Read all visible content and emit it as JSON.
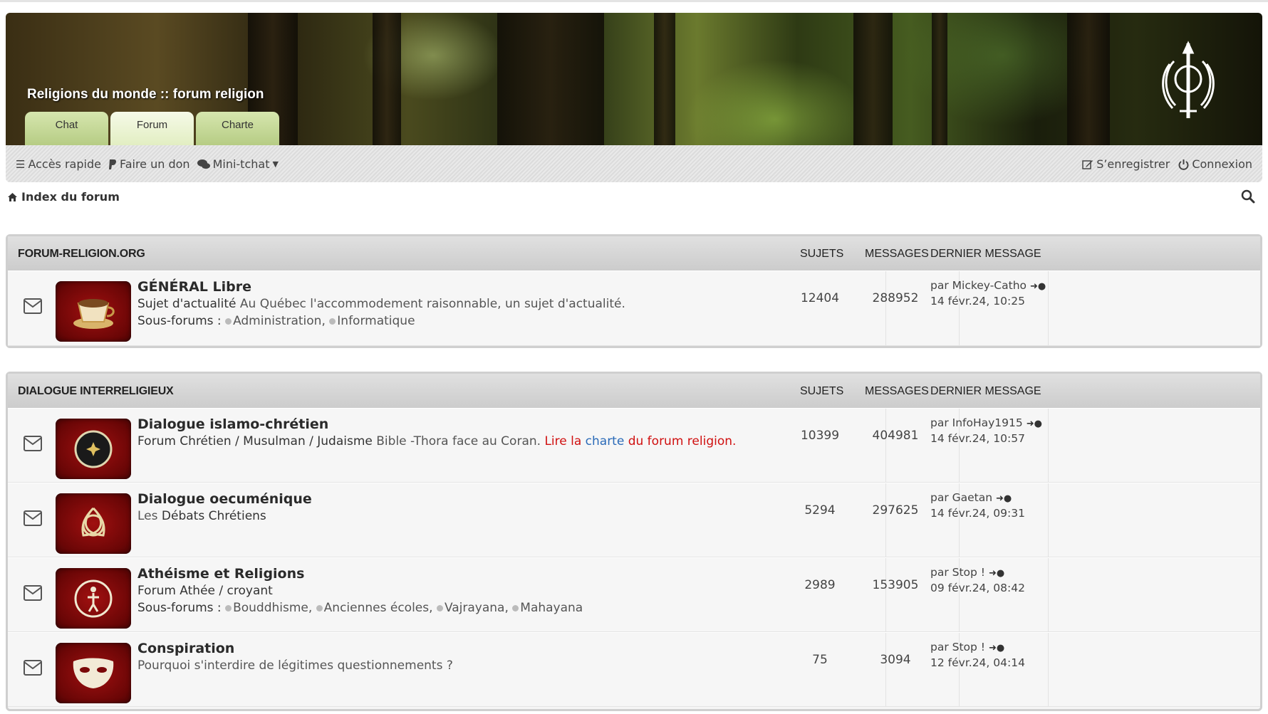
{
  "banner": {
    "title": "Religions du monde :: forum religion",
    "tabs": [
      "Chat",
      "Forum",
      "Charte"
    ]
  },
  "navbar": {
    "quick_access": "Accès rapide",
    "donate": "Faire un don",
    "minichat": "Mini-tchat",
    "register": "S’enregistrer",
    "login": "Connexion"
  },
  "breadcrumb": {
    "index": "Index du forum"
  },
  "blocks": [
    {
      "title": "FORUM-RELIGION.ORG",
      "col_topics": "SUJETS",
      "col_posts": "MESSAGES",
      "col_last": "DERNIER MESSAGE",
      "forums": [
        {
          "title": "GÉNÉRAL Libre",
          "desc_strong": "Sujet d'actualité",
          "desc_rest": " Au Québec l'accommodement raisonnable, un sujet d'actualité.",
          "subforums_label": "Sous-forums :",
          "subforums": [
            "Administration,",
            "Informatique"
          ],
          "topics": "12404",
          "posts": "288952",
          "last_by": "par Mickey-Catho",
          "last_date": "14 févr.24, 10:25"
        }
      ]
    },
    {
      "title": "DIALOGUE INTERRELIGIEUX",
      "col_topics": "SUJETS",
      "col_posts": "MESSAGES",
      "col_last": "DERNIER MESSAGE",
      "forums": [
        {
          "title": "Dialogue islamo-chrétien",
          "desc_strong": "Forum Chrétien / Musulman / Judaisme",
          "desc_rest": " Bible -Thora face au Coran. ",
          "desc_red1": "Lire la ",
          "desc_blue": "charte",
          "desc_red2": " du forum religion.",
          "topics": "10399",
          "posts": "404981",
          "last_by": "par InfoHay1915",
          "last_date": "14 févr.24, 10:57"
        },
        {
          "title": "Dialogue oecuménique",
          "desc_rest": "Les ",
          "desc_strong": "Débats Chrétiens",
          "topics": "5294",
          "posts": "297625",
          "last_by": "par Gaetan",
          "last_date": "14 févr.24, 09:31"
        },
        {
          "title": "Athéisme et Religions",
          "desc_strong": "Forum Athée / croyant",
          "subforums_label": "Sous-forums :",
          "subforums": [
            "Bouddhisme,",
            "Anciennes écoles,",
            "Vajrayana,",
            "Mahayana"
          ],
          "topics": "2989",
          "posts": "153905",
          "last_by": "par Stop !",
          "last_date": "09 févr.24, 08:42"
        },
        {
          "title": "Conspiration",
          "desc_rest": "Pourquoi s'interdire de légitimes questionnements ?",
          "topics": "75",
          "posts": "3094",
          "last_by": "par Stop !",
          "last_date": "12 févr.24, 04:14"
        }
      ]
    }
  ]
}
